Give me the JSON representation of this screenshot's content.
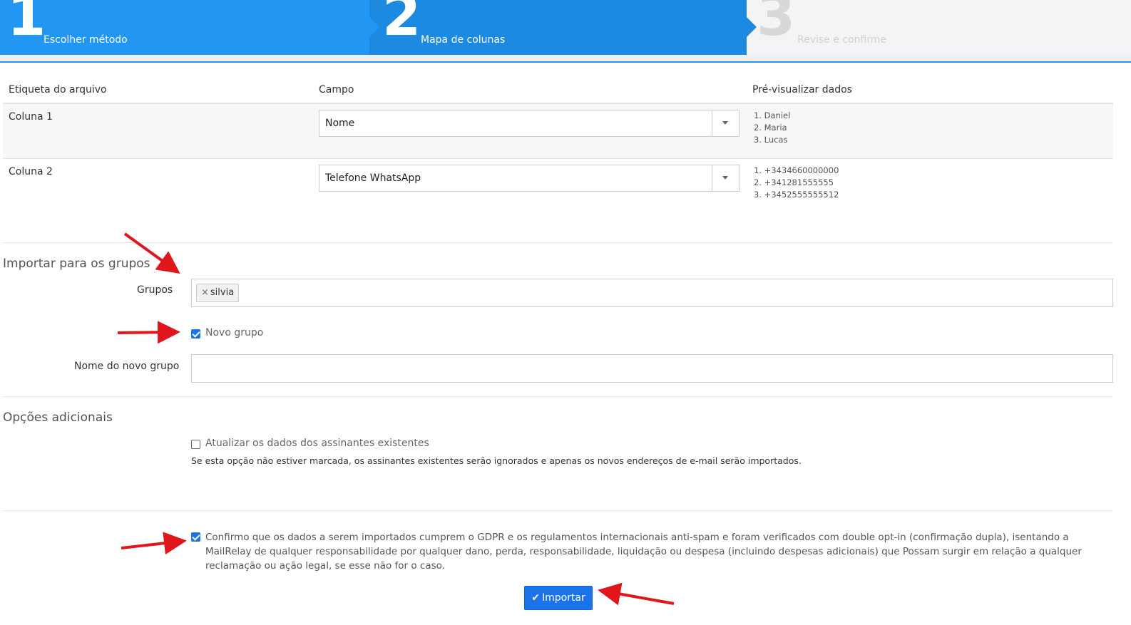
{
  "stepper": {
    "steps": [
      {
        "number": "1",
        "label": "Escolher método"
      },
      {
        "number": "2",
        "label": "Mapa de colunas"
      },
      {
        "number": "3",
        "label": "Revise e confirme"
      }
    ]
  },
  "mapping": {
    "headers": {
      "file_label": "Etiqueta do arquivo",
      "field": "Campo",
      "preview": "Pré-visualizar dados"
    },
    "rows": [
      {
        "label": "Coluna 1",
        "field": "Nome",
        "preview": [
          "1. Daniel",
          "2. Maria",
          "3. Lucas"
        ]
      },
      {
        "label": "Coluna 2",
        "field": "Telefone WhatsApp",
        "preview": [
          "1. +3434660000000",
          "2. +341281555555",
          "3. +3452555555512"
        ]
      }
    ]
  },
  "groups_section": {
    "title": "Importar para os grupos",
    "groups_label": "Grupos",
    "tags": [
      {
        "remove": "×",
        "text": "silvia"
      }
    ],
    "new_group_label": "Novo grupo",
    "new_group_checked": true,
    "new_group_name_label": "Nome do novo grupo",
    "new_group_name_value": ""
  },
  "options_section": {
    "title": "Opções adicionais",
    "update_label": "Atualizar os dados dos assinantes existentes",
    "update_checked": false,
    "help": "Se esta opção não estiver marcada, os assinantes existentes serão ignorados e apenas os novos endereços de e-mail serão importados."
  },
  "gdpr": {
    "checked": true,
    "text": "Confirmo que os dados a serem importados cumprem o GDPR e os regulamentos internacionais anti-spam e foram verificados com double opt-in (confirmação dupla), isentando a MailRelay de qualquer responsabilidade por qualquer dano, perda, responsabilidade, liquidação ou despesa (incluindo despesas adicionais) que Possam surgir em relação a qualquer reclamação ou ação legal, se esse não for o caso."
  },
  "import_button": {
    "label": "Importar",
    "icon": "check-icon"
  },
  "colors": {
    "step_active": "#2196f3",
    "step_current": "#1c8ae0",
    "primary": "#1a73e8",
    "annotation_arrow": "#e0161b"
  }
}
